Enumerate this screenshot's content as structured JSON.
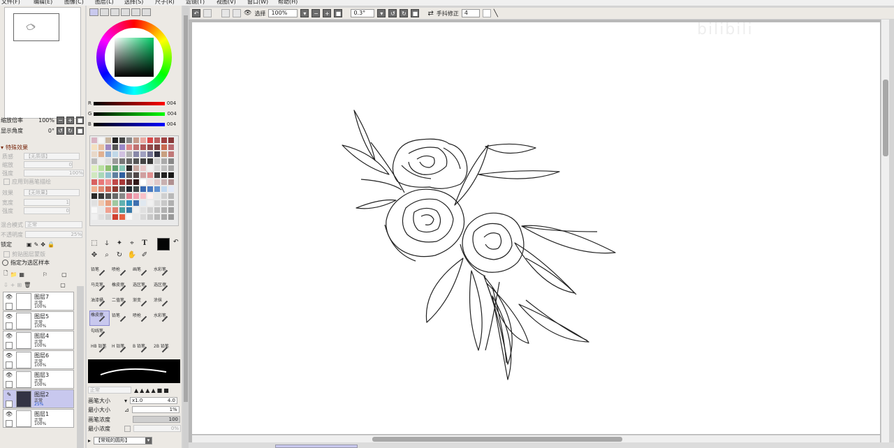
{
  "menu": [
    "文件(F)",
    "编辑(E)",
    "图像(C)",
    "图层(L)",
    "选择(S)",
    "尺子(R)",
    "滤镜(T)",
    "视图(V)",
    "窗口(W)",
    "帮助(H)"
  ],
  "toolbar": {
    "select_label": "选择",
    "zoom_value": "100%",
    "angle_value": "0.3°",
    "stabilizer_label": "手抖修正",
    "stabilizer_value": "4"
  },
  "navigator": {
    "zoom_label": "缩放倍率",
    "zoom_value": "100%",
    "angle_label": "显示角度",
    "angle_value": "0°"
  },
  "effects": {
    "header": "特殊效果",
    "texture_label": "质感",
    "texture_value": "【无质感】",
    "scale_label": "缩放",
    "scale_value": "0",
    "strength_label": "强度",
    "strength_value": "100%",
    "apply_brush": "应用到画笔描绘",
    "effect_label": "效果",
    "effect_value": "【无效果】",
    "width_label": "宽度",
    "width_value": "1",
    "strength2_label": "强度",
    "strength2_value": "0",
    "blend_label": "混合模式",
    "blend_value": "正常",
    "opacity_label": "不透明度",
    "opacity_value": "25%",
    "lock_label": "锁定",
    "clip_label": "剪贴图层蒙版",
    "sample_label": "指定为选区样本"
  },
  "layers": [
    {
      "name": "图层7",
      "mode": "正常",
      "opacity": "100%",
      "visible": true,
      "active": false
    },
    {
      "name": "图层5",
      "mode": "正常",
      "opacity": "100%",
      "visible": true,
      "active": false
    },
    {
      "name": "图层4",
      "mode": "正常",
      "opacity": "100%",
      "visible": true,
      "active": false
    },
    {
      "name": "图层6",
      "mode": "正常",
      "opacity": "100%",
      "visible": true,
      "active": false
    },
    {
      "name": "图层3",
      "mode": "正常",
      "opacity": "100%",
      "visible": true,
      "active": false
    },
    {
      "name": "图层2",
      "mode": "正常",
      "opacity": "25%",
      "visible": false,
      "active": true
    },
    {
      "name": "图层1",
      "mode": "正常",
      "opacity": "100%",
      "visible": true,
      "active": false
    }
  ],
  "color": {
    "r_label": "R",
    "r_value": "004",
    "g_label": "G",
    "g_value": "004",
    "b_label": "B",
    "b_value": "004",
    "main_color": "#040404"
  },
  "brushes": [
    {
      "label": "铅笔",
      "selected": false
    },
    {
      "label": "喷枪",
      "selected": false
    },
    {
      "label": "画笔",
      "selected": false
    },
    {
      "label": "水彩笔",
      "selected": false
    },
    {
      "label": "马克笔",
      "selected": false
    },
    {
      "label": "橡皮擦",
      "selected": false
    },
    {
      "label": "选区笔",
      "selected": false
    },
    {
      "label": "选区擦",
      "selected": false
    },
    {
      "label": "油漆桶",
      "selected": false
    },
    {
      "label": "二值笔",
      "selected": false
    },
    {
      "label": "渐变",
      "selected": false
    },
    {
      "label": "涂抹",
      "selected": false
    },
    {
      "label": "橡皮擦",
      "selected": true
    },
    {
      "label": "铅笔",
      "selected": false
    },
    {
      "label": "喷枪",
      "selected": false
    },
    {
      "label": "水彩笔",
      "selected": false
    },
    {
      "label": "勾线笔",
      "selected": false
    },
    {
      "label": "",
      "selected": false
    },
    {
      "label": "",
      "selected": false
    },
    {
      "label": "",
      "selected": false
    },
    {
      "label": "HB 铅笔",
      "selected": false
    },
    {
      "label": "H 铅笔",
      "selected": false
    },
    {
      "label": "B 铅笔",
      "selected": false
    },
    {
      "label": "2B 铅笔",
      "selected": false
    }
  ],
  "brush_settings": {
    "mode_value": "正常",
    "size_label": "画笔大小",
    "size_mult": "x1.0",
    "size_value": "4.0",
    "min_size_label": "最小大小",
    "min_size_value": "1%",
    "density_label": "画笔浓度",
    "density_value": "100",
    "min_density_label": "最小浓度",
    "min_density_value": "0%",
    "shape_label": "【常规的圆形】"
  },
  "watermark": "bilibili"
}
